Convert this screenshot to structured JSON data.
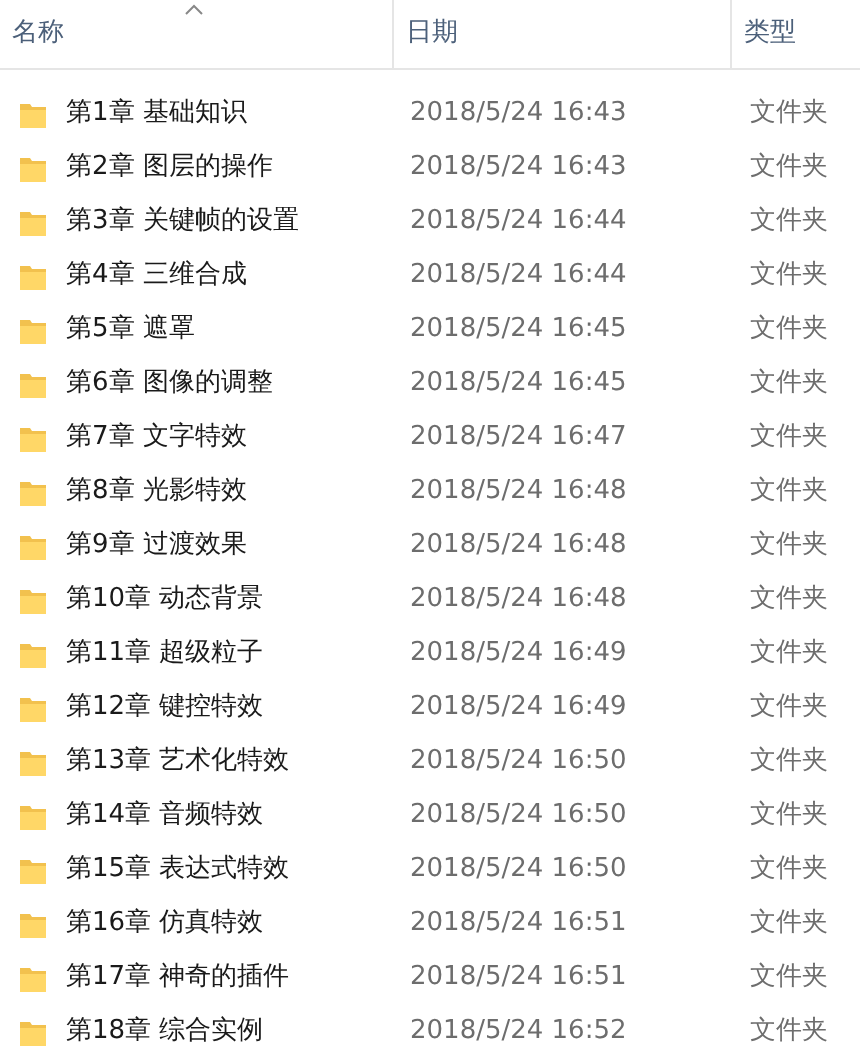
{
  "columns": [
    {
      "label": "名称",
      "sorted": true
    },
    {
      "label": "日期",
      "sorted": false
    },
    {
      "label": "类型",
      "sorted": false
    }
  ],
  "rows": [
    {
      "name": "第1章 基础知识",
      "date": "2018/5/24 16:43",
      "type": "文件夹"
    },
    {
      "name": "第2章 图层的操作",
      "date": "2018/5/24 16:43",
      "type": "文件夹"
    },
    {
      "name": "第3章 关键帧的设置",
      "date": "2018/5/24 16:44",
      "type": "文件夹"
    },
    {
      "name": "第4章 三维合成",
      "date": "2018/5/24 16:44",
      "type": "文件夹"
    },
    {
      "name": "第5章 遮罩",
      "date": "2018/5/24 16:45",
      "type": "文件夹"
    },
    {
      "name": "第6章 图像的调整",
      "date": "2018/5/24 16:45",
      "type": "文件夹"
    },
    {
      "name": "第7章 文字特效",
      "date": "2018/5/24 16:47",
      "type": "文件夹"
    },
    {
      "name": "第8章 光影特效",
      "date": "2018/5/24 16:48",
      "type": "文件夹"
    },
    {
      "name": "第9章 过渡效果",
      "date": "2018/5/24 16:48",
      "type": "文件夹"
    },
    {
      "name": "第10章 动态背景",
      "date": "2018/5/24 16:48",
      "type": "文件夹"
    },
    {
      "name": "第11章 超级粒子",
      "date": "2018/5/24 16:49",
      "type": "文件夹"
    },
    {
      "name": "第12章 键控特效",
      "date": "2018/5/24 16:49",
      "type": "文件夹"
    },
    {
      "name": "第13章 艺术化特效",
      "date": "2018/5/24 16:50",
      "type": "文件夹"
    },
    {
      "name": "第14章 音频特效",
      "date": "2018/5/24 16:50",
      "type": "文件夹"
    },
    {
      "name": "第15章 表达式特效",
      "date": "2018/5/24 16:50",
      "type": "文件夹"
    },
    {
      "name": "第16章 仿真特效",
      "date": "2018/5/24 16:51",
      "type": "文件夹"
    },
    {
      "name": "第17章 神奇的插件",
      "date": "2018/5/24 16:51",
      "type": "文件夹"
    },
    {
      "name": "第18章 综合实例",
      "date": "2018/5/24 16:52",
      "type": "文件夹"
    }
  ]
}
